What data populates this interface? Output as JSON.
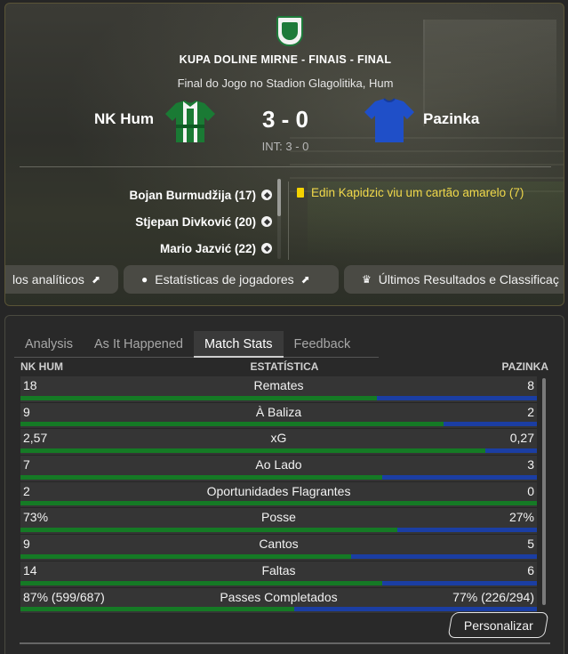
{
  "header": {
    "competition": "KUPA DOLINE MIRNE - FINAIS - FINAL",
    "venue": "Final do Jogo no Stadion Glagolitika, Hum",
    "home_team": "NK Hum",
    "away_team": "Pazinka",
    "score": "3 - 0",
    "aggregate": "INT: 3 - 0",
    "home_kit_colors": [
      "#1a7a34",
      "#f4f4f4"
    ],
    "away_kit_color": "#1f4fc8",
    "scorers": [
      {
        "name": "Bojan Burmudžija (17)",
        "icon": "ball-icon"
      },
      {
        "name": "Stjepan Divković (20)",
        "icon": "ball-icon"
      },
      {
        "name": "Mario Jazvić (22)",
        "icon": "ball-icon"
      }
    ],
    "events": [
      {
        "text": "Edin Kapidzic viu um cartão amarelo (7)",
        "icon": "yellow-card-icon"
      }
    ],
    "buttons": [
      {
        "label": "los analíticos",
        "icon": "external-link-icon"
      },
      {
        "label": "Estatísticas de jogadores",
        "icon": "external-link-icon"
      },
      {
        "label": "Últimos Resultados e Classificaç",
        "icon": "trophy-icon"
      }
    ]
  },
  "stats": {
    "tabs": [
      "Analysis",
      "As It Happened",
      "Match Stats",
      "Feedback"
    ],
    "active_tab": "Match Stats",
    "columns": {
      "home": "NK HUM",
      "stat": "ESTATÍSTICA",
      "away": "PAZINKA"
    },
    "rows": [
      {
        "label": "Remates",
        "home": "18",
        "away": "8",
        "home_share": 0.69
      },
      {
        "label": "À Baliza",
        "home": "9",
        "away": "2",
        "home_share": 0.82
      },
      {
        "label": "xG",
        "home": "2,57",
        "away": "0,27",
        "home_share": 0.9
      },
      {
        "label": "Ao Lado",
        "home": "7",
        "away": "3",
        "home_share": 0.7
      },
      {
        "label": "Oportunidades Flagrantes",
        "home": "2",
        "away": "0",
        "home_share": 1.0
      },
      {
        "label": "Posse",
        "home": "73%",
        "away": "27%",
        "home_share": 0.73
      },
      {
        "label": "Cantos",
        "home": "9",
        "away": "5",
        "home_share": 0.64
      },
      {
        "label": "Faltas",
        "home": "14",
        "away": "6",
        "home_share": 0.7
      },
      {
        "label": "Passes Completados",
        "home": "87% (599/687)",
        "away": "77% (226/294)",
        "home_share": 0.53
      }
    ],
    "customize_label": "Personalizar",
    "colors": {
      "home_bar": "#157a25",
      "away_bar": "#1b3ea3"
    }
  }
}
